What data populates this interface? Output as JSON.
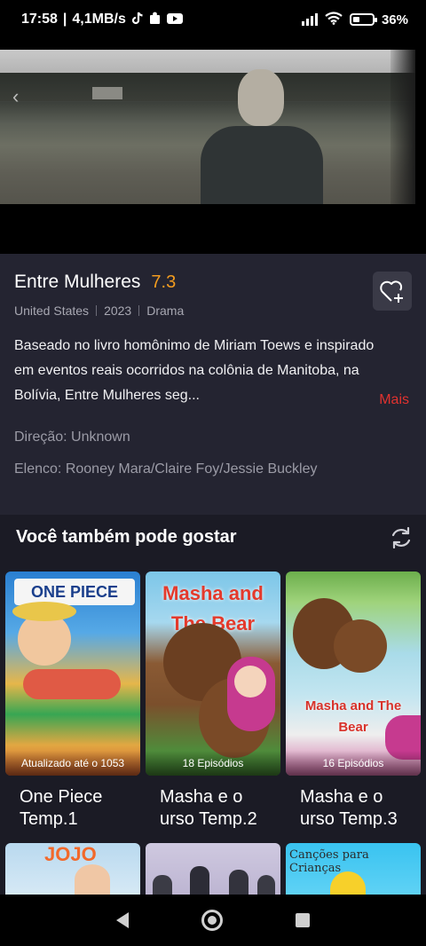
{
  "status_bar": {
    "time": "17:58",
    "net_speed": "4,1MB/s",
    "battery": "36%",
    "battery_fraction": 0.36,
    "icons": [
      "tiktok-icon",
      "puzzle-icon",
      "youtube-icon",
      "signal-icon",
      "wifi-icon",
      "battery-icon"
    ]
  },
  "movie": {
    "title": "Entre Mulheres",
    "rating": "7.3",
    "country": "United States",
    "year": "2023",
    "genre": "Drama",
    "description": "Baseado no livro homônimo de Miriam Toews e inspirado em eventos reais ocorridos na colônia de Manitoba, na Bolívia, Entre Mulheres seg...",
    "more_label": "Mais",
    "director": "Direção: Unknown",
    "cast": "Elenco: Rooney Mara/Claire Foy/Jessie Buckley"
  },
  "recommendations": {
    "heading": "Você também pode gostar",
    "items": [
      {
        "title": "One Piece Temp.1",
        "badge": "Atualizado até o 1053",
        "logo": "ONE PIECE"
      },
      {
        "title": "Masha e o urso Temp.2",
        "badge": "18 Episódios",
        "logo": "Masha and The Bear"
      },
      {
        "title": "Masha e o urso Temp.3",
        "badge": "16 Episódios",
        "logo": "Masha and The Bear"
      }
    ],
    "next_row": [
      {
        "logo": "JOJO"
      },
      {
        "logo": ""
      },
      {
        "logo": "Canções para Crianças"
      }
    ]
  },
  "colors": {
    "accent_rating": "#f39c1f",
    "more_link": "#e0322f",
    "panel": "#242431",
    "background": "#1b1b25"
  }
}
